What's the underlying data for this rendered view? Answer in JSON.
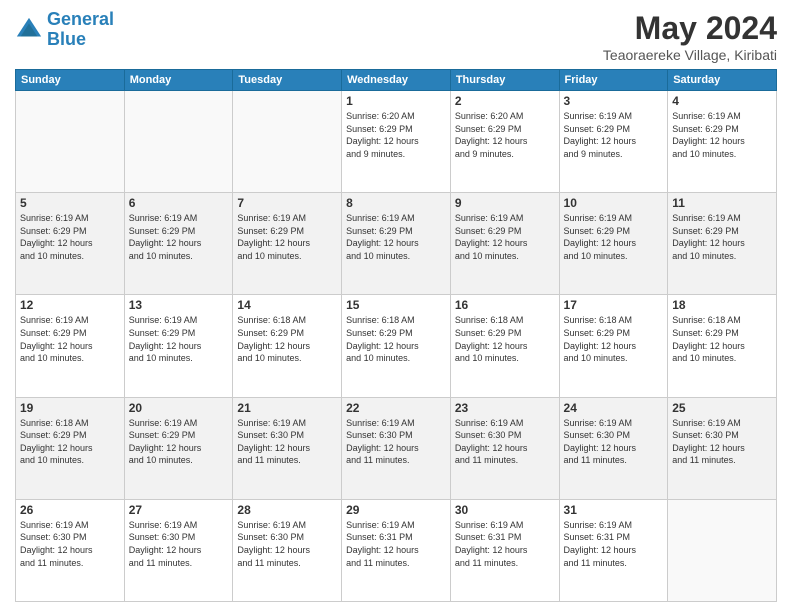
{
  "logo": {
    "line1": "General",
    "line2": "Blue"
  },
  "header": {
    "month": "May 2024",
    "location": "Teaoraereke Village, Kiribati"
  },
  "weekdays": [
    "Sunday",
    "Monday",
    "Tuesday",
    "Wednesday",
    "Thursday",
    "Friday",
    "Saturday"
  ],
  "weeks": [
    [
      {
        "day": "",
        "info": ""
      },
      {
        "day": "",
        "info": ""
      },
      {
        "day": "",
        "info": ""
      },
      {
        "day": "1",
        "info": "Sunrise: 6:20 AM\nSunset: 6:29 PM\nDaylight: 12 hours\nand 9 minutes."
      },
      {
        "day": "2",
        "info": "Sunrise: 6:20 AM\nSunset: 6:29 PM\nDaylight: 12 hours\nand 9 minutes."
      },
      {
        "day": "3",
        "info": "Sunrise: 6:19 AM\nSunset: 6:29 PM\nDaylight: 12 hours\nand 9 minutes."
      },
      {
        "day": "4",
        "info": "Sunrise: 6:19 AM\nSunset: 6:29 PM\nDaylight: 12 hours\nand 10 minutes."
      }
    ],
    [
      {
        "day": "5",
        "info": "Sunrise: 6:19 AM\nSunset: 6:29 PM\nDaylight: 12 hours\nand 10 minutes."
      },
      {
        "day": "6",
        "info": "Sunrise: 6:19 AM\nSunset: 6:29 PM\nDaylight: 12 hours\nand 10 minutes."
      },
      {
        "day": "7",
        "info": "Sunrise: 6:19 AM\nSunset: 6:29 PM\nDaylight: 12 hours\nand 10 minutes."
      },
      {
        "day": "8",
        "info": "Sunrise: 6:19 AM\nSunset: 6:29 PM\nDaylight: 12 hours\nand 10 minutes."
      },
      {
        "day": "9",
        "info": "Sunrise: 6:19 AM\nSunset: 6:29 PM\nDaylight: 12 hours\nand 10 minutes."
      },
      {
        "day": "10",
        "info": "Sunrise: 6:19 AM\nSunset: 6:29 PM\nDaylight: 12 hours\nand 10 minutes."
      },
      {
        "day": "11",
        "info": "Sunrise: 6:19 AM\nSunset: 6:29 PM\nDaylight: 12 hours\nand 10 minutes."
      }
    ],
    [
      {
        "day": "12",
        "info": "Sunrise: 6:19 AM\nSunset: 6:29 PM\nDaylight: 12 hours\nand 10 minutes."
      },
      {
        "day": "13",
        "info": "Sunrise: 6:19 AM\nSunset: 6:29 PM\nDaylight: 12 hours\nand 10 minutes."
      },
      {
        "day": "14",
        "info": "Sunrise: 6:18 AM\nSunset: 6:29 PM\nDaylight: 12 hours\nand 10 minutes."
      },
      {
        "day": "15",
        "info": "Sunrise: 6:18 AM\nSunset: 6:29 PM\nDaylight: 12 hours\nand 10 minutes."
      },
      {
        "day": "16",
        "info": "Sunrise: 6:18 AM\nSunset: 6:29 PM\nDaylight: 12 hours\nand 10 minutes."
      },
      {
        "day": "17",
        "info": "Sunrise: 6:18 AM\nSunset: 6:29 PM\nDaylight: 12 hours\nand 10 minutes."
      },
      {
        "day": "18",
        "info": "Sunrise: 6:18 AM\nSunset: 6:29 PM\nDaylight: 12 hours\nand 10 minutes."
      }
    ],
    [
      {
        "day": "19",
        "info": "Sunrise: 6:18 AM\nSunset: 6:29 PM\nDaylight: 12 hours\nand 10 minutes."
      },
      {
        "day": "20",
        "info": "Sunrise: 6:19 AM\nSunset: 6:29 PM\nDaylight: 12 hours\nand 10 minutes."
      },
      {
        "day": "21",
        "info": "Sunrise: 6:19 AM\nSunset: 6:30 PM\nDaylight: 12 hours\nand 11 minutes."
      },
      {
        "day": "22",
        "info": "Sunrise: 6:19 AM\nSunset: 6:30 PM\nDaylight: 12 hours\nand 11 minutes."
      },
      {
        "day": "23",
        "info": "Sunrise: 6:19 AM\nSunset: 6:30 PM\nDaylight: 12 hours\nand 11 minutes."
      },
      {
        "day": "24",
        "info": "Sunrise: 6:19 AM\nSunset: 6:30 PM\nDaylight: 12 hours\nand 11 minutes."
      },
      {
        "day": "25",
        "info": "Sunrise: 6:19 AM\nSunset: 6:30 PM\nDaylight: 12 hours\nand 11 minutes."
      }
    ],
    [
      {
        "day": "26",
        "info": "Sunrise: 6:19 AM\nSunset: 6:30 PM\nDaylight: 12 hours\nand 11 minutes."
      },
      {
        "day": "27",
        "info": "Sunrise: 6:19 AM\nSunset: 6:30 PM\nDaylight: 12 hours\nand 11 minutes."
      },
      {
        "day": "28",
        "info": "Sunrise: 6:19 AM\nSunset: 6:30 PM\nDaylight: 12 hours\nand 11 minutes."
      },
      {
        "day": "29",
        "info": "Sunrise: 6:19 AM\nSunset: 6:31 PM\nDaylight: 12 hours\nand 11 minutes."
      },
      {
        "day": "30",
        "info": "Sunrise: 6:19 AM\nSunset: 6:31 PM\nDaylight: 12 hours\nand 11 minutes."
      },
      {
        "day": "31",
        "info": "Sunrise: 6:19 AM\nSunset: 6:31 PM\nDaylight: 12 hours\nand 11 minutes."
      },
      {
        "day": "",
        "info": ""
      }
    ]
  ]
}
